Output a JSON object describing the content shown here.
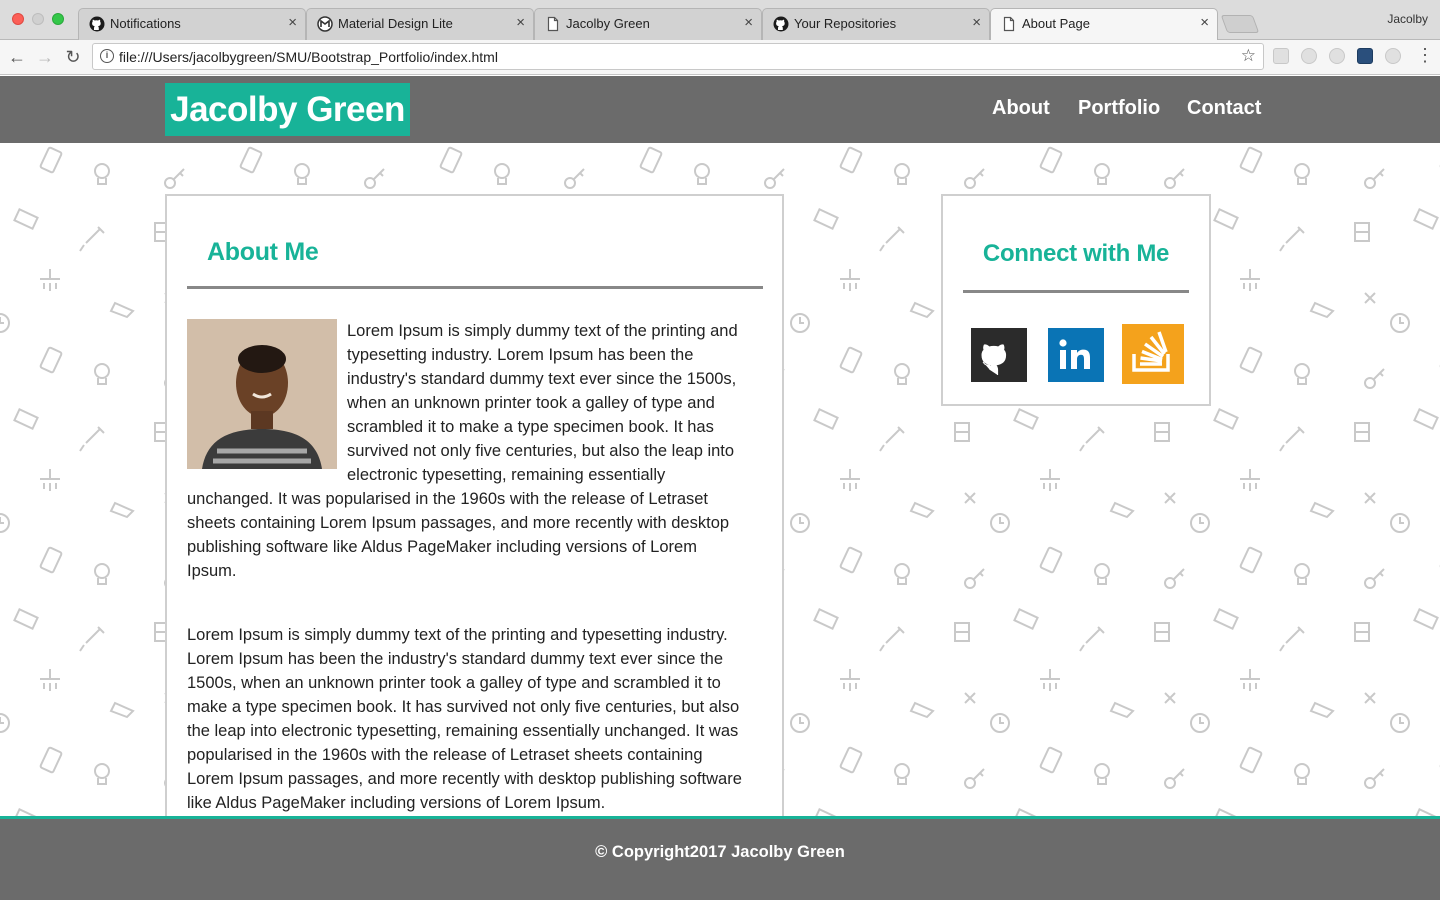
{
  "browser": {
    "tabs": [
      {
        "title": "Notifications",
        "icon": "github-icon"
      },
      {
        "title": "Material Design Lite",
        "icon": "material-icon"
      },
      {
        "title": "Jacolby Green",
        "icon": "page-icon"
      },
      {
        "title": "Your Repositories",
        "icon": "github-icon"
      },
      {
        "title": "About Page",
        "icon": "page-icon",
        "active": true
      }
    ],
    "profile_name": "Jacolby",
    "url": "file:///Users/jacolbygreen/SMU/Bootstrap_Portfolio/index.html"
  },
  "header": {
    "brand": "Jacolby Green",
    "nav": [
      "About",
      "Portfolio",
      "Contact"
    ]
  },
  "about": {
    "title": "About Me",
    "photo_alt": "Portrait of Jacolby Green",
    "paragraph1_lines": [
      "Lorem Ipsum is simply dummy text of the printing and",
      "typesetting industry. Lorem Ipsum has been the",
      "industry's standard dummy text ever since the 1500s,",
      "when an unknown printer took a galley of type and",
      "scrambled it to make a type specimen book. It has",
      "survived not only five centuries, but also the leap into",
      "electronic typesetting, remaining essentially",
      "unchanged. It was popularised in the 1960s with the release of Letraset",
      "sheets containing Lorem Ipsum passages, and more recently with desktop",
      "publishing software like Aldus PageMaker including versions of Lorem",
      "Ipsum."
    ],
    "paragraph2_lines": [
      "Lorem Ipsum is simply dummy text of the printing and typesetting industry.",
      "Lorem Ipsum has been the industry's standard dummy text ever since the",
      "1500s, when an unknown printer took a galley of type and scrambled it to",
      "make a type specimen book. It has survived not only five centuries, but also",
      "the leap into electronic typesetting, remaining essentially unchanged. It was",
      "popularised in the 1960s with the release of Letraset sheets containing",
      "Lorem Ipsum passages, and more recently with desktop publishing software",
      "like Aldus PageMaker including versions of Lorem Ipsum."
    ]
  },
  "connect": {
    "title": "Connect with Me",
    "links": [
      {
        "name": "GitHub",
        "icon": "github-icon",
        "color": "#2b2b2b"
      },
      {
        "name": "LinkedIn",
        "icon": "linkedin-icon",
        "color": "#0a74b5"
      },
      {
        "name": "Stack Overflow",
        "icon": "stackoverflow-icon",
        "color": "#f4a21c"
      }
    ]
  },
  "footer": {
    "copyright": "© Copyright2017 Jacolby Green"
  },
  "colors": {
    "accent": "#18b398",
    "header_bg": "#6b6b6b"
  }
}
